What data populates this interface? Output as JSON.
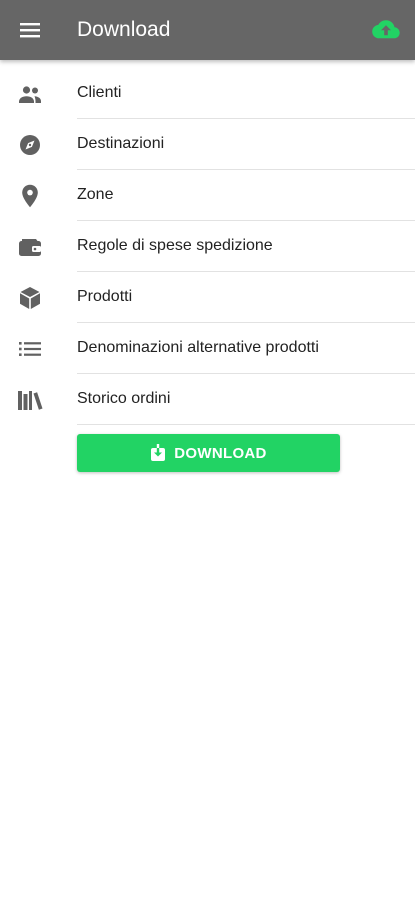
{
  "appbar": {
    "title": "Download",
    "menu_icon": "hamburger-menu-icon",
    "action_icon": "cloud-upload-icon",
    "action_color": "#22d364",
    "background": "#666666"
  },
  "list": {
    "items": [
      {
        "label": "Clienti",
        "icon": "people-icon"
      },
      {
        "label": "Destinazioni",
        "icon": "compass-icon"
      },
      {
        "label": "Zone",
        "icon": "location-pin-icon"
      },
      {
        "label": "Regole di spese spedizione",
        "icon": "wallet-icon"
      },
      {
        "label": "Prodotti",
        "icon": "box-icon"
      },
      {
        "label": "Denominazioni alternative prodotti",
        "icon": "list-icon"
      },
      {
        "label": "Storico ordini",
        "icon": "library-icon"
      }
    ],
    "icon_color": "#616161"
  },
  "download_button": {
    "label": "DOWNLOAD",
    "icon": "download-icon",
    "color": "#22d364"
  }
}
